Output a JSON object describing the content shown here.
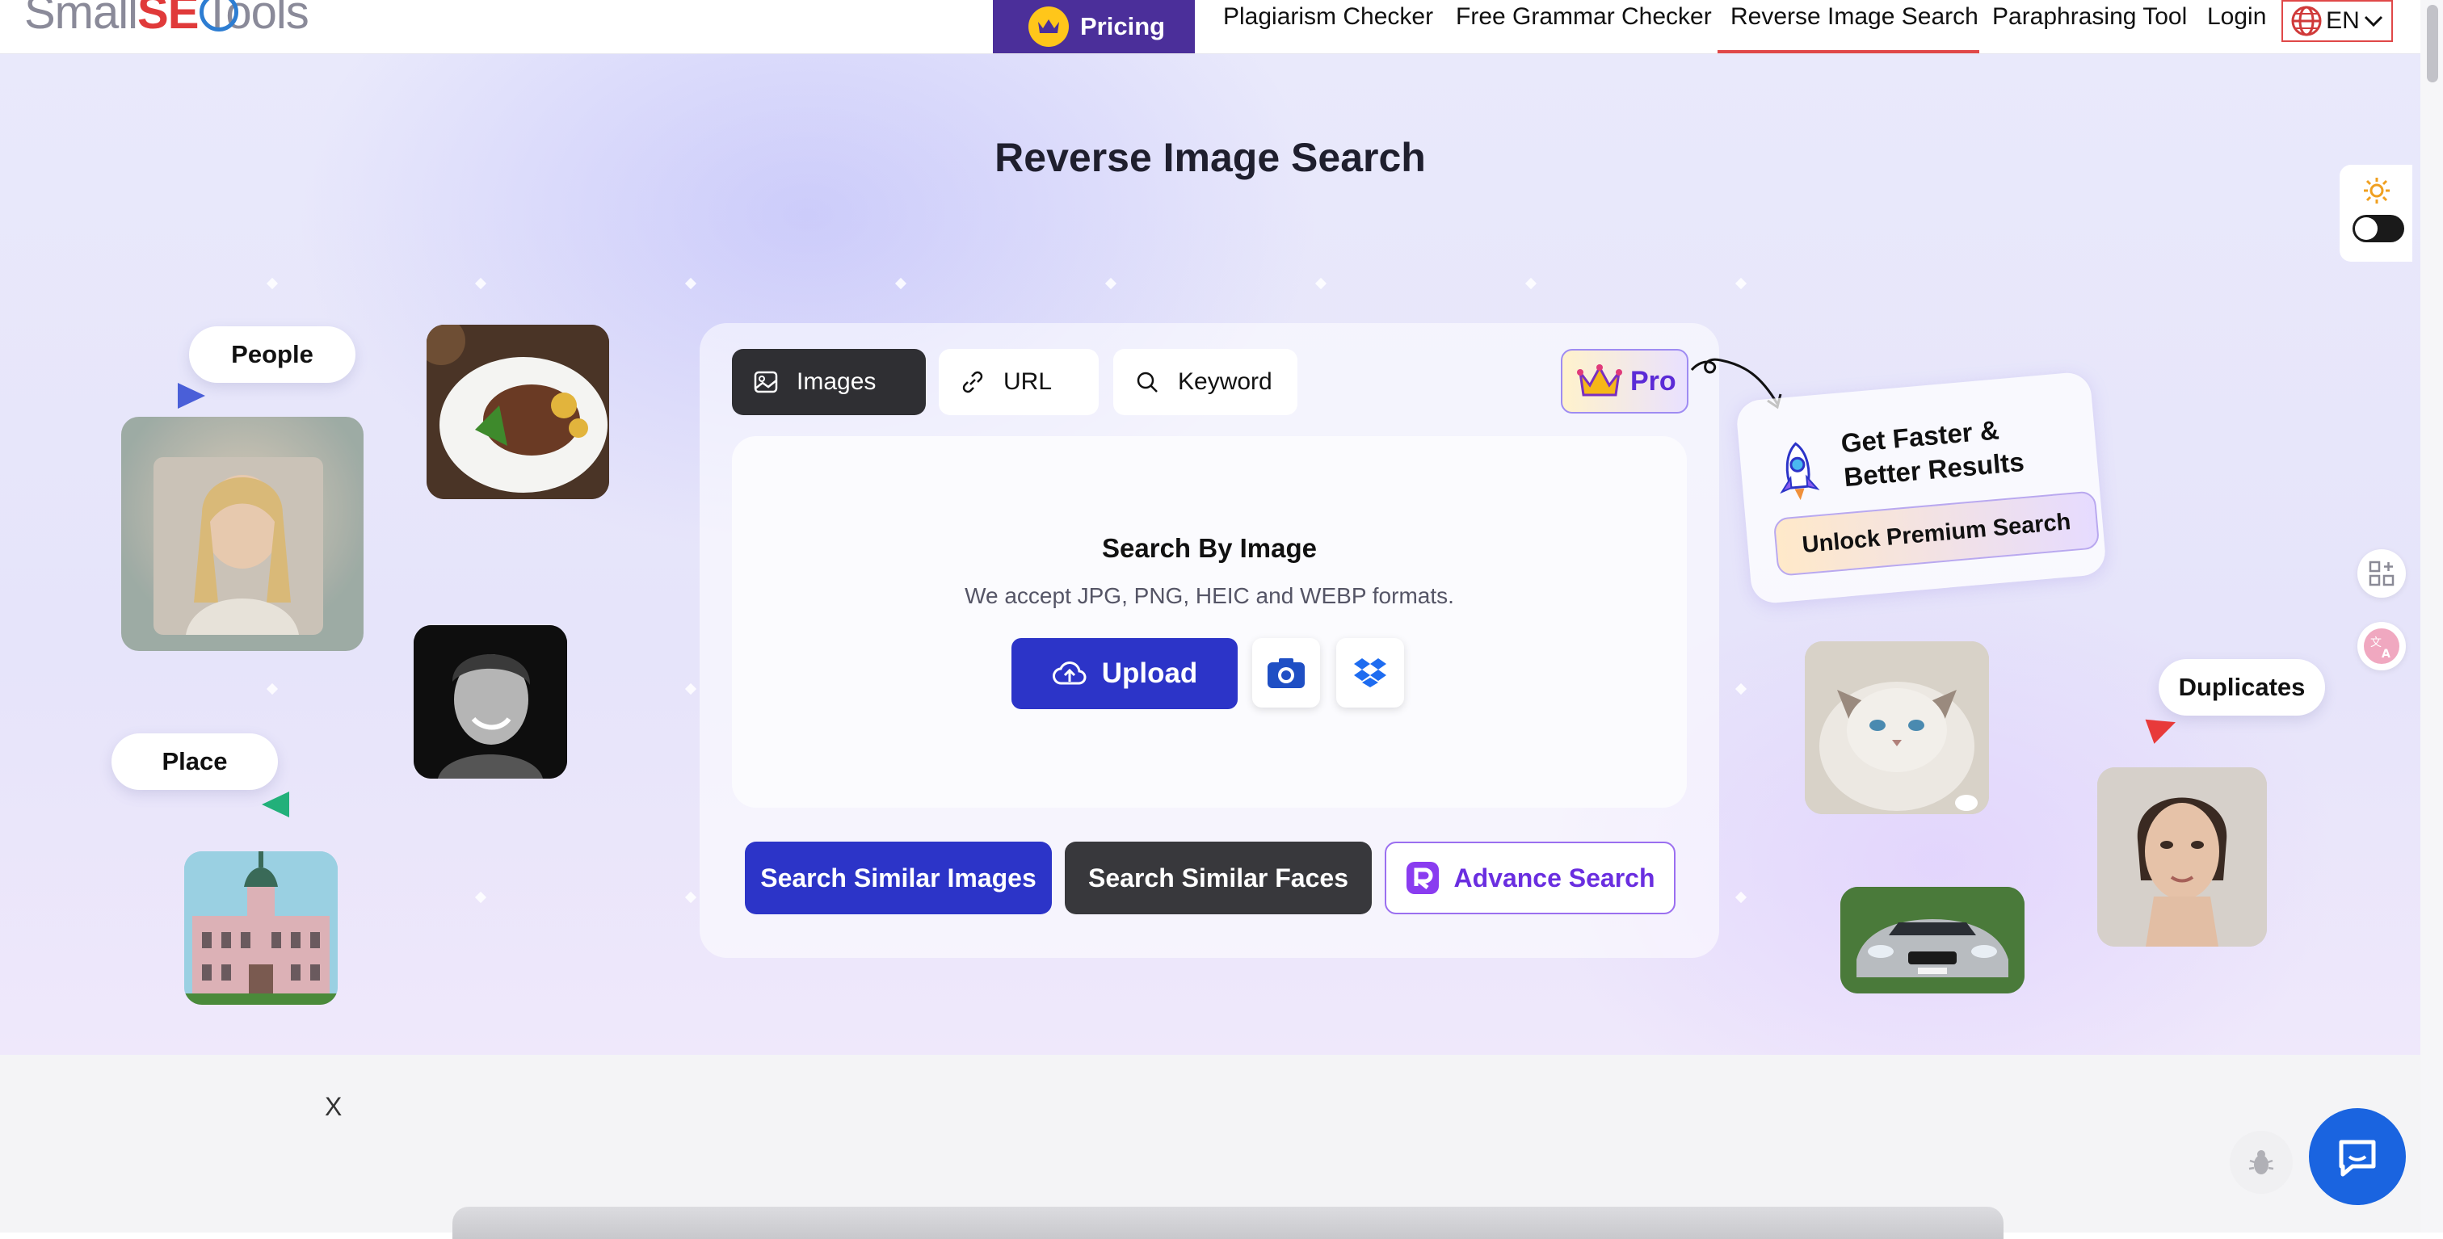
{
  "nav": {
    "logo_part1": "Small",
    "logo_part2": "SE",
    "logo_part3": "Tools",
    "pricing": "Pricing",
    "items": [
      "Plagiarism Checker",
      "Free Grammar Checker",
      "Reverse Image Search",
      "Paraphrasing Tool",
      "Login"
    ],
    "active_item": "Reverse Image Search",
    "language": "EN"
  },
  "page_title": "Reverse Image Search",
  "search_card": {
    "tabs": [
      "Images",
      "URL",
      "Keyword"
    ],
    "active_tab": "Images",
    "pro_label": "Pro",
    "drop_title": "Search By Image",
    "drop_subtitle": "We accept JPG, PNG, HEIC and WEBP formats.",
    "upload_label": "Upload",
    "buttons": {
      "similar_images": "Search Similar Images",
      "similar_faces": "Search Similar Faces",
      "advance": "Advance Search"
    }
  },
  "promo": {
    "title_line1": "Get Faster &",
    "title_line2": "Better Results",
    "button": "Unlock Premium Search"
  },
  "labels": {
    "people": "People",
    "place": "Place",
    "duplicates": "Duplicates"
  },
  "footer": {
    "close": "X"
  },
  "colors": {
    "primary": "#2c34c8",
    "pricing_bg": "#4b2f9a",
    "active_underline": "#e04848",
    "pro_text": "#5b2bd6",
    "chat": "#1a64e0"
  }
}
